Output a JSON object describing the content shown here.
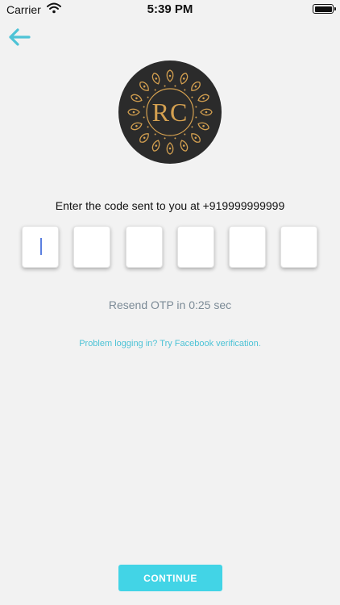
{
  "status_bar": {
    "carrier": "Carrier",
    "time": "5:39 PM",
    "wifi_icon": "wifi-icon",
    "battery_icon": "battery-icon",
    "battery_level": 1.0
  },
  "back_icon": "arrow-left-icon",
  "logo": {
    "monogram": "RC"
  },
  "prompt": "Enter the code sent to you at +919999999999",
  "otp": {
    "boxes": [
      "",
      "",
      "",
      "",
      "",
      ""
    ]
  },
  "resend_text": "Resend OTP in 0:25 sec",
  "problem_link": "Problem logging in? Try Facebook verification.",
  "continue_label": "CONTINUE",
  "colors": {
    "accent": "#42d4e6",
    "link": "#4ec3d6",
    "back_arrow": "#4ec3d6",
    "logo_bg": "#2b2b2b",
    "logo_gold": "#d4a050"
  }
}
